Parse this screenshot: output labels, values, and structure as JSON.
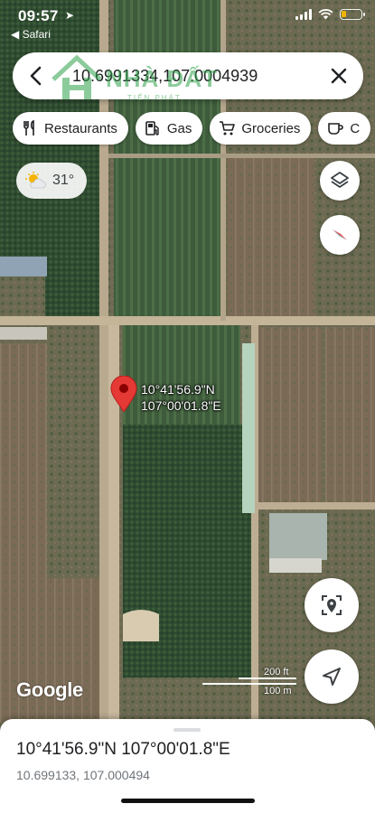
{
  "status_bar": {
    "time": "09:57",
    "back_app": "◀ Safari"
  },
  "search": {
    "query": "10.6991334,107.0004939",
    "watermark": "NHÀ ĐẤT",
    "watermark_sub": "TIẾN PHÁT"
  },
  "chips": [
    {
      "label": "Restaurants",
      "icon": "fork-knife-icon"
    },
    {
      "label": "Gas",
      "icon": "gas-pump-icon"
    },
    {
      "label": "Groceries",
      "icon": "cart-icon"
    },
    {
      "label": "C",
      "icon": "coffee-icon"
    }
  ],
  "weather": {
    "temp": "31°",
    "icon": "partly-cloudy-icon"
  },
  "pin": {
    "lat_label": "10°41'56.9\"N",
    "lng_label": "107°00'01.8\"E"
  },
  "map": {
    "logo": "Google",
    "scale_top": "200 ft",
    "scale_bottom": "100 m"
  },
  "sheet": {
    "title": "10°41'56.9\"N 107°00'01.8\"E",
    "subtitle": "10.699133, 107.000494"
  },
  "colors": {
    "pin_red": "#e53935",
    "accent_blue": "#1a73e8",
    "battery": "#f0b400"
  }
}
